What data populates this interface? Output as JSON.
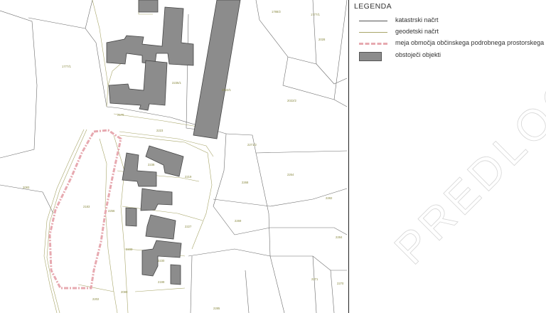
{
  "legend": {
    "title": "LEGENDA",
    "items": [
      {
        "label": "katastrski načrt",
        "swatch": "thin-dark-line"
      },
      {
        "label": "geodetski načrt",
        "swatch": "thin-olive-line"
      },
      {
        "label": "meja območja občinskega podrobnega prostorskega na",
        "swatch": "pink-dash-dot-line"
      },
      {
        "label": "obstoječi objekti",
        "swatch": "grey-box"
      }
    ]
  },
  "watermark": "PREDLOG",
  "parcel_labels": [
    "1788/2",
    "1777/1",
    "2028",
    "1777/1",
    "2235/1",
    "2022/1",
    "2022/2",
    "2170",
    "2223",
    "2271/2",
    "2264",
    "2268",
    "2282",
    "2083",
    "2183",
    "2238",
    "2219",
    "2256",
    "2227",
    "2230",
    "2199",
    "2269",
    "2233",
    "2271",
    "2270",
    "2285",
    "2080",
    "2202",
    "2284"
  ],
  "colors": {
    "building_fill": "#8c8c8c",
    "building_stroke": "#444444",
    "cadastral_line": "#555555",
    "geodetic_line": "#a8a66a",
    "boundary": "#e7a9b0"
  }
}
